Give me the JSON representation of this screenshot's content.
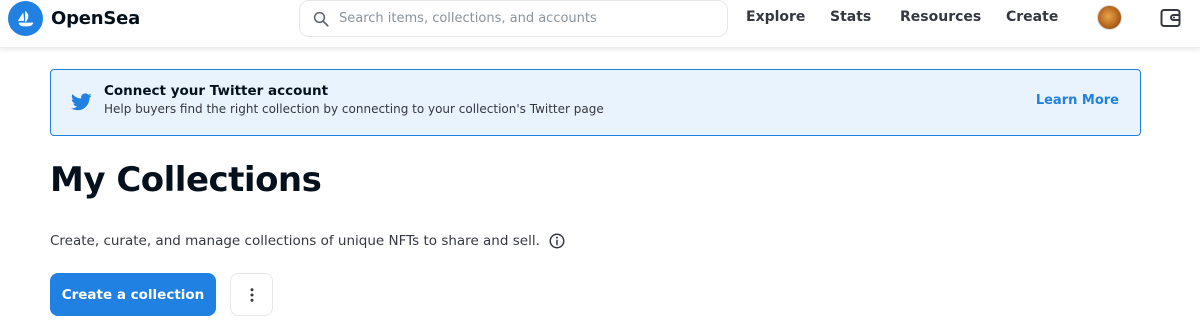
{
  "header": {
    "brand": "OpenSea",
    "search_placeholder": "Search items, collections, and accounts",
    "nav": [
      {
        "label": "Explore"
      },
      {
        "label": "Stats"
      },
      {
        "label": "Resources"
      },
      {
        "label": "Create"
      }
    ],
    "icons": {
      "logo": "opensea-logo-icon",
      "search": "search-icon",
      "avatar": "user-avatar",
      "wallet": "wallet-icon"
    }
  },
  "banner": {
    "icon": "twitter-icon",
    "title": "Connect your Twitter account",
    "description": "Help buyers find the right collection by connecting to your collection's Twitter page",
    "link": "Learn More"
  },
  "main": {
    "title": "My Collections",
    "subtitle": "Create, curate, and manage collections of unique NFTs to share and sell.",
    "info_icon": "info-icon",
    "create_button": "Create a collection",
    "more_button_icon": "more-vertical-icon"
  },
  "colors": {
    "accent": "#2081e2",
    "banner_bg": "#e9f3fd",
    "text": "#04111d",
    "muted": "#353840"
  }
}
